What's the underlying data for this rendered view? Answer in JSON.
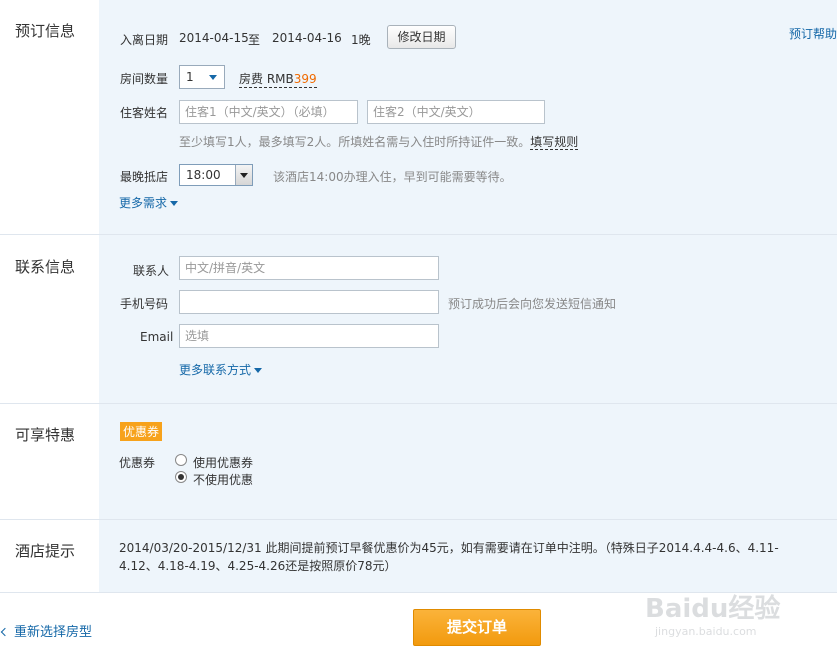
{
  "booking": {
    "title": "预订信息",
    "help_link": "预订帮助",
    "dates": {
      "label": "入离日期",
      "checkin": "2014-04-15",
      "to": "至",
      "checkout": "2014-04-16",
      "nights": "1晚",
      "change_button": "修改日期"
    },
    "rooms": {
      "label": "房间数量",
      "value": "1",
      "price_label": "房费 RMB",
      "price": "399"
    },
    "guests": {
      "label": "住客姓名",
      "guest1_placeholder": "住客1（中文/英文）（必填）",
      "guest2_placeholder": "住客2（中文/英文）",
      "hint": "至少填写1人，最多填写2人。所填姓名需与入住时所持证件一致。",
      "rules_link": "填写规则"
    },
    "arrival": {
      "label": "最晚抵店",
      "value": "18:00",
      "hint": "该酒店14:00办理入住，早到可能需要等待。"
    },
    "more_needs": "更多需求"
  },
  "contact": {
    "title": "联系信息",
    "name_label": "联系人",
    "name_placeholder": "中文/拼音/英文",
    "phone_label": "手机号码",
    "phone_placeholder": "",
    "phone_hint": "预订成功后会向您发送短信通知",
    "email_label": "Email",
    "email_placeholder": "选填",
    "more_contact": "更多联系方式"
  },
  "offers": {
    "title": "可享特惠",
    "badge": "优惠券",
    "coupon_label": "优惠券",
    "options": [
      "使用优惠券",
      "不使用优惠"
    ],
    "selected_index": 1
  },
  "notice": {
    "title": "酒店提示",
    "line1": "2014/03/20-2015/12/31 此期间提前预订早餐优惠价为45元，如有需要请在订单中注明。（特殊日子2014.4.4-4.6、4.11-",
    "line2": "4.12、4.18-4.19、4.25-4.26还是按照原价78元）"
  },
  "footer": {
    "back_link": "重新选择房型",
    "submit_button": "提交订单",
    "watermark_text": "Baidu经验",
    "watermark_url": "jingyan.baidu.com"
  },
  "colors": {
    "accent_blue": "#1568a8",
    "price_orange": "#f06a00",
    "submit_orange": "#f7a21b",
    "panel_bg": "#eef5fb"
  }
}
